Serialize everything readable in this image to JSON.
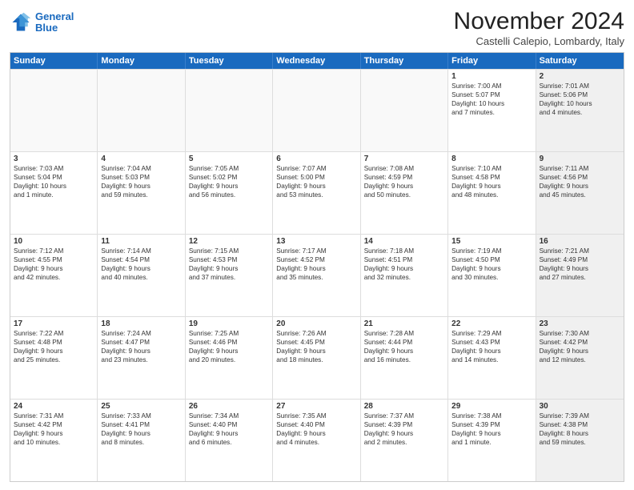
{
  "logo": {
    "line1": "General",
    "line2": "Blue"
  },
  "title": "November 2024",
  "subtitle": "Castelli Calepio, Lombardy, Italy",
  "header_days": [
    "Sunday",
    "Monday",
    "Tuesday",
    "Wednesday",
    "Thursday",
    "Friday",
    "Saturday"
  ],
  "rows": [
    [
      {
        "day": "",
        "lines": [],
        "empty": true
      },
      {
        "day": "",
        "lines": [],
        "empty": true
      },
      {
        "day": "",
        "lines": [],
        "empty": true
      },
      {
        "day": "",
        "lines": [],
        "empty": true
      },
      {
        "day": "",
        "lines": [],
        "empty": true
      },
      {
        "day": "1",
        "lines": [
          "Sunrise: 7:00 AM",
          "Sunset: 5:07 PM",
          "Daylight: 10 hours",
          "and 7 minutes."
        ],
        "empty": false,
        "shaded": false
      },
      {
        "day": "2",
        "lines": [
          "Sunrise: 7:01 AM",
          "Sunset: 5:06 PM",
          "Daylight: 10 hours",
          "and 4 minutes."
        ],
        "empty": false,
        "shaded": true
      }
    ],
    [
      {
        "day": "3",
        "lines": [
          "Sunrise: 7:03 AM",
          "Sunset: 5:04 PM",
          "Daylight: 10 hours",
          "and 1 minute."
        ],
        "empty": false,
        "shaded": false
      },
      {
        "day": "4",
        "lines": [
          "Sunrise: 7:04 AM",
          "Sunset: 5:03 PM",
          "Daylight: 9 hours",
          "and 59 minutes."
        ],
        "empty": false,
        "shaded": false
      },
      {
        "day": "5",
        "lines": [
          "Sunrise: 7:05 AM",
          "Sunset: 5:02 PM",
          "Daylight: 9 hours",
          "and 56 minutes."
        ],
        "empty": false,
        "shaded": false
      },
      {
        "day": "6",
        "lines": [
          "Sunrise: 7:07 AM",
          "Sunset: 5:00 PM",
          "Daylight: 9 hours",
          "and 53 minutes."
        ],
        "empty": false,
        "shaded": false
      },
      {
        "day": "7",
        "lines": [
          "Sunrise: 7:08 AM",
          "Sunset: 4:59 PM",
          "Daylight: 9 hours",
          "and 50 minutes."
        ],
        "empty": false,
        "shaded": false
      },
      {
        "day": "8",
        "lines": [
          "Sunrise: 7:10 AM",
          "Sunset: 4:58 PM",
          "Daylight: 9 hours",
          "and 48 minutes."
        ],
        "empty": false,
        "shaded": false
      },
      {
        "day": "9",
        "lines": [
          "Sunrise: 7:11 AM",
          "Sunset: 4:56 PM",
          "Daylight: 9 hours",
          "and 45 minutes."
        ],
        "empty": false,
        "shaded": true
      }
    ],
    [
      {
        "day": "10",
        "lines": [
          "Sunrise: 7:12 AM",
          "Sunset: 4:55 PM",
          "Daylight: 9 hours",
          "and 42 minutes."
        ],
        "empty": false,
        "shaded": false
      },
      {
        "day": "11",
        "lines": [
          "Sunrise: 7:14 AM",
          "Sunset: 4:54 PM",
          "Daylight: 9 hours",
          "and 40 minutes."
        ],
        "empty": false,
        "shaded": false
      },
      {
        "day": "12",
        "lines": [
          "Sunrise: 7:15 AM",
          "Sunset: 4:53 PM",
          "Daylight: 9 hours",
          "and 37 minutes."
        ],
        "empty": false,
        "shaded": false
      },
      {
        "day": "13",
        "lines": [
          "Sunrise: 7:17 AM",
          "Sunset: 4:52 PM",
          "Daylight: 9 hours",
          "and 35 minutes."
        ],
        "empty": false,
        "shaded": false
      },
      {
        "day": "14",
        "lines": [
          "Sunrise: 7:18 AM",
          "Sunset: 4:51 PM",
          "Daylight: 9 hours",
          "and 32 minutes."
        ],
        "empty": false,
        "shaded": false
      },
      {
        "day": "15",
        "lines": [
          "Sunrise: 7:19 AM",
          "Sunset: 4:50 PM",
          "Daylight: 9 hours",
          "and 30 minutes."
        ],
        "empty": false,
        "shaded": false
      },
      {
        "day": "16",
        "lines": [
          "Sunrise: 7:21 AM",
          "Sunset: 4:49 PM",
          "Daylight: 9 hours",
          "and 27 minutes."
        ],
        "empty": false,
        "shaded": true
      }
    ],
    [
      {
        "day": "17",
        "lines": [
          "Sunrise: 7:22 AM",
          "Sunset: 4:48 PM",
          "Daylight: 9 hours",
          "and 25 minutes."
        ],
        "empty": false,
        "shaded": false
      },
      {
        "day": "18",
        "lines": [
          "Sunrise: 7:24 AM",
          "Sunset: 4:47 PM",
          "Daylight: 9 hours",
          "and 23 minutes."
        ],
        "empty": false,
        "shaded": false
      },
      {
        "day": "19",
        "lines": [
          "Sunrise: 7:25 AM",
          "Sunset: 4:46 PM",
          "Daylight: 9 hours",
          "and 20 minutes."
        ],
        "empty": false,
        "shaded": false
      },
      {
        "day": "20",
        "lines": [
          "Sunrise: 7:26 AM",
          "Sunset: 4:45 PM",
          "Daylight: 9 hours",
          "and 18 minutes."
        ],
        "empty": false,
        "shaded": false
      },
      {
        "day": "21",
        "lines": [
          "Sunrise: 7:28 AM",
          "Sunset: 4:44 PM",
          "Daylight: 9 hours",
          "and 16 minutes."
        ],
        "empty": false,
        "shaded": false
      },
      {
        "day": "22",
        "lines": [
          "Sunrise: 7:29 AM",
          "Sunset: 4:43 PM",
          "Daylight: 9 hours",
          "and 14 minutes."
        ],
        "empty": false,
        "shaded": false
      },
      {
        "day": "23",
        "lines": [
          "Sunrise: 7:30 AM",
          "Sunset: 4:42 PM",
          "Daylight: 9 hours",
          "and 12 minutes."
        ],
        "empty": false,
        "shaded": true
      }
    ],
    [
      {
        "day": "24",
        "lines": [
          "Sunrise: 7:31 AM",
          "Sunset: 4:42 PM",
          "Daylight: 9 hours",
          "and 10 minutes."
        ],
        "empty": false,
        "shaded": false
      },
      {
        "day": "25",
        "lines": [
          "Sunrise: 7:33 AM",
          "Sunset: 4:41 PM",
          "Daylight: 9 hours",
          "and 8 minutes."
        ],
        "empty": false,
        "shaded": false
      },
      {
        "day": "26",
        "lines": [
          "Sunrise: 7:34 AM",
          "Sunset: 4:40 PM",
          "Daylight: 9 hours",
          "and 6 minutes."
        ],
        "empty": false,
        "shaded": false
      },
      {
        "day": "27",
        "lines": [
          "Sunrise: 7:35 AM",
          "Sunset: 4:40 PM",
          "Daylight: 9 hours",
          "and 4 minutes."
        ],
        "empty": false,
        "shaded": false
      },
      {
        "day": "28",
        "lines": [
          "Sunrise: 7:37 AM",
          "Sunset: 4:39 PM",
          "Daylight: 9 hours",
          "and 2 minutes."
        ],
        "empty": false,
        "shaded": false
      },
      {
        "day": "29",
        "lines": [
          "Sunrise: 7:38 AM",
          "Sunset: 4:39 PM",
          "Daylight: 9 hours",
          "and 1 minute."
        ],
        "empty": false,
        "shaded": false
      },
      {
        "day": "30",
        "lines": [
          "Sunrise: 7:39 AM",
          "Sunset: 4:38 PM",
          "Daylight: 8 hours",
          "and 59 minutes."
        ],
        "empty": false,
        "shaded": true
      }
    ]
  ]
}
